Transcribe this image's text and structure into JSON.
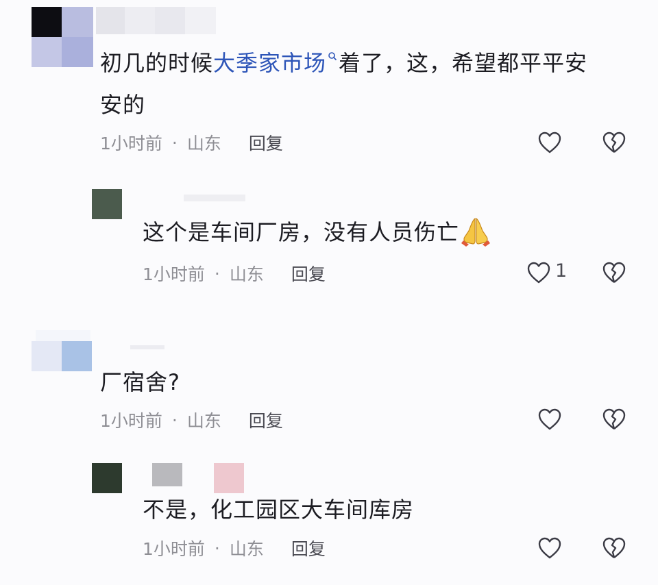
{
  "comments": [
    {
      "content_prefix": "初几的时候",
      "content_link": "大季家市场",
      "content_suffix_line1": "着了，这，希望都平平安",
      "content_line2": "安的",
      "time": "1小时前",
      "separator": "·",
      "location": "山东",
      "reply": "回复",
      "like_icon": "heart-outline-icon",
      "dislike_icon": "broken-heart-icon"
    },
    {
      "content": "这个是车间厂房，没有人员伤亡",
      "emoji": "folded-hands-emoji",
      "time": "1小时前",
      "separator": "·",
      "location": "山东",
      "reply": "回复",
      "like_count": "1",
      "like_icon": "heart-outline-icon",
      "dislike_icon": "broken-heart-icon"
    },
    {
      "content": "厂宿舍?",
      "time": "1小时前",
      "separator": "·",
      "location": "山东",
      "reply": "回复",
      "like_icon": "heart-outline-icon",
      "dislike_icon": "broken-heart-icon"
    },
    {
      "content": "不是，化工园区大车间库房",
      "time": "1小时前",
      "separator": "·",
      "location": "山东",
      "reply": "回复",
      "like_icon": "heart-outline-icon",
      "dislike_icon": "broken-heart-icon"
    }
  ],
  "colors": {
    "link": "#2d55b8",
    "meta": "#8e8e94",
    "text": "#1c1c22",
    "icon": "#3a3a44"
  }
}
